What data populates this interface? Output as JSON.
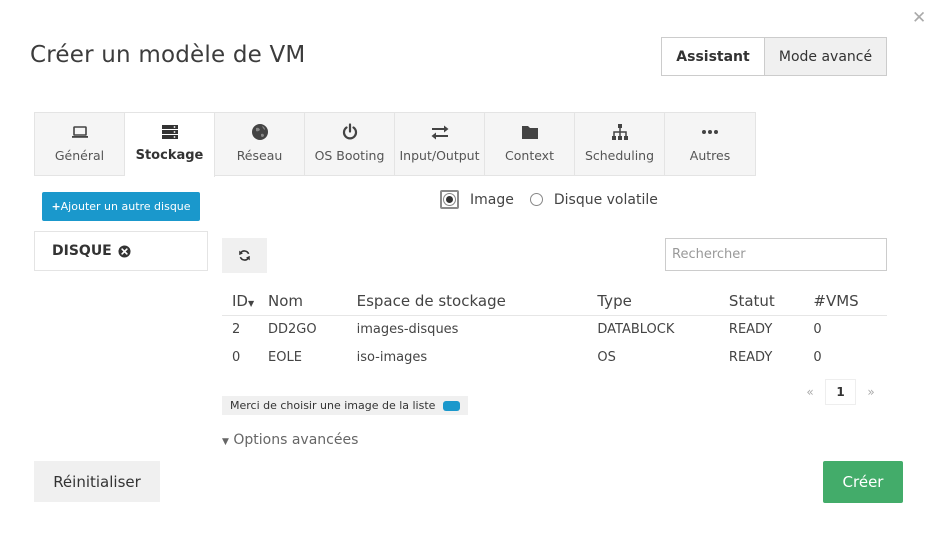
{
  "dialog": {
    "title": "Créer un modèle de VM",
    "close_icon": "close-icon"
  },
  "modes": {
    "wizard_label": "Assistant",
    "advanced_label": "Mode avancé",
    "active": "wizard"
  },
  "tabs": [
    {
      "label": "Général",
      "icon": "laptop-icon",
      "active": false
    },
    {
      "label": "Stockage",
      "icon": "storage-icon",
      "active": true
    },
    {
      "label": "Réseau",
      "icon": "globe-icon",
      "active": false
    },
    {
      "label": "OS Booting",
      "icon": "power-icon",
      "active": false
    },
    {
      "label": "Input/Output",
      "icon": "exchange-icon",
      "active": false
    },
    {
      "label": "Context",
      "icon": "folder-icon",
      "active": false
    },
    {
      "label": "Scheduling",
      "icon": "sitemap-icon",
      "active": false
    },
    {
      "label": "Autres",
      "icon": "ellipsis-icon",
      "active": false
    }
  ],
  "storage": {
    "add_disk_label": "Ajouter un autre disque",
    "disk_label": "DISQUE",
    "source_options": [
      {
        "label": "Image",
        "selected": true
      },
      {
        "label": "Disque volatile",
        "selected": false
      }
    ],
    "search_placeholder": "Rechercher",
    "table": {
      "columns": [
        "ID",
        "Nom",
        "Espace de stockage",
        "Type",
        "Statut",
        "#VMS"
      ],
      "rows": [
        [
          "2",
          "DD2GO",
          "images-disques",
          "DATABLOCK",
          "READY",
          "0"
        ],
        [
          "0",
          "EOLE",
          "iso-images",
          "OS",
          "READY",
          "0"
        ]
      ]
    },
    "pagination": {
      "prev": "«",
      "current": "1",
      "next": "»"
    },
    "hint": "Merci de choisir une image de la liste",
    "advanced_options": "Options avancées"
  },
  "footer": {
    "reset_label": "Réinitialiser",
    "create_label": "Créer"
  },
  "colors": {
    "primary": "#1a98cc",
    "success": "#43ac6a"
  }
}
